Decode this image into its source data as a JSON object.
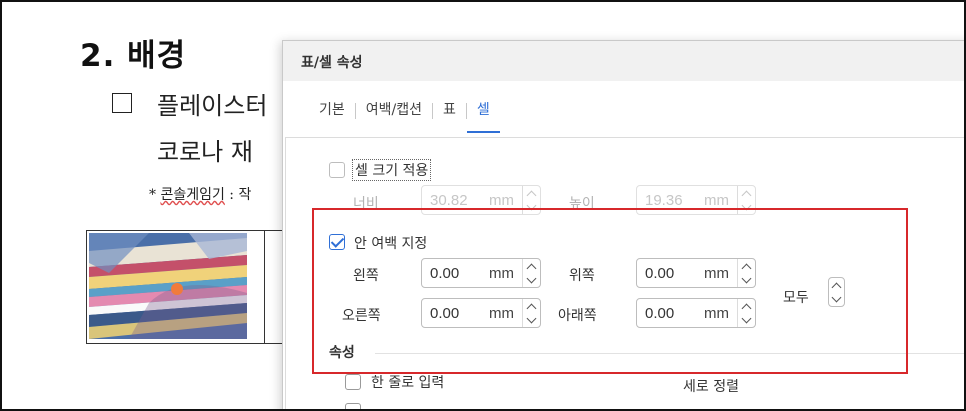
{
  "document": {
    "heading": "2. 배경",
    "line1": "플레이스터",
    "line2": "코로나 재",
    "note_prefix": "* ",
    "note_word": "콘솔게임기",
    "note_suffix": " : 작"
  },
  "dialog": {
    "title": "표/셀 속성",
    "tabs": [
      "기본",
      "여백/캡션",
      "표",
      "셀"
    ],
    "active_tab": "셀",
    "cell_size": {
      "label": "셀 크기 적용",
      "checked": false,
      "width": {
        "label": "너비",
        "value": "30.82",
        "unit": "mm"
      },
      "height": {
        "label": "높이",
        "value": "19.36",
        "unit": "mm"
      }
    },
    "inner_margin": {
      "label": "안 여백 지정",
      "checked": true,
      "left": {
        "label": "왼쪽",
        "value": "0.00",
        "unit": "mm"
      },
      "top": {
        "label": "위쪽",
        "value": "0.00",
        "unit": "mm"
      },
      "right": {
        "label": "오른쪽",
        "value": "0.00",
        "unit": "mm"
      },
      "bottom": {
        "label": "아래쪽",
        "value": "0.00",
        "unit": "mm"
      },
      "all_label": "모두"
    },
    "properties": {
      "section_title": "속성",
      "single_line_input": {
        "label": "한 줄로 입력",
        "checked": false
      },
      "vertical_align_label": "세로 정렬"
    }
  },
  "colors": {
    "accent": "#2f6fd6",
    "highlight_box": "#d7282b",
    "disabled_text": "#b3b3b3",
    "titlebar": "#f1f1f1"
  }
}
